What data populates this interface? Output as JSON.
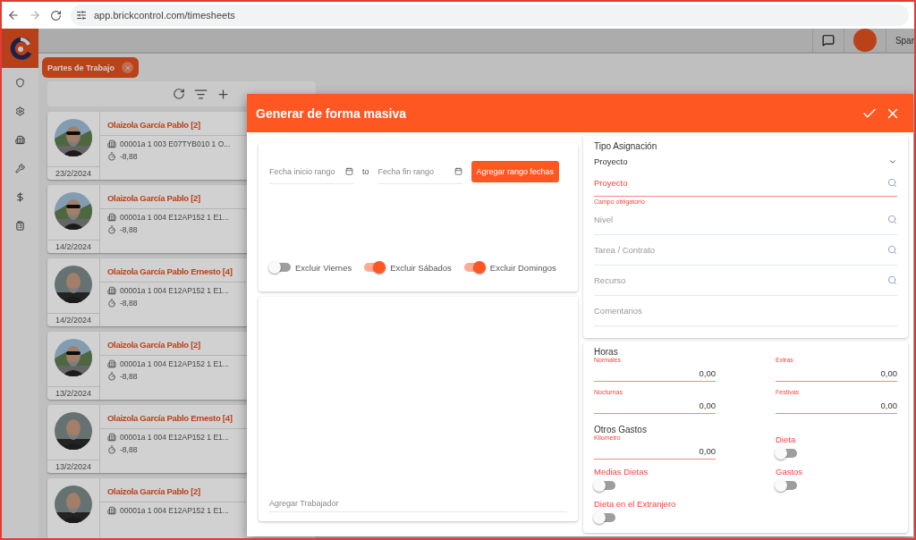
{
  "browser": {
    "url": "app.brickcontrol.com/timesheets"
  },
  "header": {
    "user_name": "Spar"
  },
  "tabs": [
    {
      "label": "Partes de Trabajo",
      "selected": true
    }
  ],
  "timesheets": [
    {
      "name": "Olaizola García Pablo [2]",
      "project": "00001a 1 003 E07TYB010 1 O...",
      "hours": "-8,88",
      "date": "23/2/2024"
    },
    {
      "name": "Olaizola García Pablo [2]",
      "project": "00001a 1 004 E12AP152 1 E1...",
      "hours": "-8,88",
      "date": "14/2/2024"
    },
    {
      "name": "Olaizola García Pablo Ernesto [4]",
      "project": "00001a 1 004 E12AP152 1 E1...",
      "hours": "-8,88",
      "date": "14/2/2024"
    },
    {
      "name": "Olaizola García Pablo [2]",
      "project": "00001a 1 004 E12AP152 1 E1...",
      "hours": "-8,88",
      "date": "13/2/2024"
    },
    {
      "name": "Olaizola García Pablo Ernesto [4]",
      "project": "00001a 1 004 E12AP152 1 E1...",
      "hours": "-8,88",
      "date": "13/2/2024"
    },
    {
      "name": "Olaizola García Pablo [2]",
      "project": "00001a 1 004 E12AP152 1 E1..."
    }
  ],
  "dialog": {
    "title": "Generar de forma masiva",
    "date_range": {
      "start_placeholder": "Fecha inicio rango",
      "separator": "to",
      "end_placeholder": "Fecha fin rango",
      "add_button": "Agregar rango fechas"
    },
    "exclusions": [
      {
        "label": "Excluir Viernes",
        "on": false
      },
      {
        "label": "Excluir Sábados",
        "on": true
      },
      {
        "label": "Excluir Domingos",
        "on": true
      }
    ],
    "worker_field": {
      "placeholder": "Agregar Trabajador"
    },
    "assignment": {
      "label": "Tipo Asignación",
      "value": "Proyecto",
      "search_fields": [
        {
          "placeholder": "Proyecto",
          "error": "Campo obligatorio"
        },
        {
          "placeholder": "Nivel"
        },
        {
          "placeholder": "Tarea / Contrato"
        },
        {
          "placeholder": "Recurso"
        }
      ],
      "comments": {
        "placeholder": "Comentarios"
      }
    },
    "hours": {
      "title": "Horas",
      "fields": [
        {
          "label": "Normales",
          "value": "0,00"
        },
        {
          "label": "Extras",
          "value": "0,00"
        },
        {
          "label": "Nocturnas",
          "value": "0,00"
        },
        {
          "label": "Festivas",
          "value": "0,00"
        }
      ]
    },
    "other_expenses": {
      "title": "Otros Gastos",
      "items": [
        {
          "kind": "number",
          "label": "Kilometro",
          "value": "0,00"
        },
        {
          "kind": "toggle",
          "label": "Dieta",
          "on": false
        },
        {
          "kind": "toggle",
          "label": "Medias Dietas",
          "on": false
        },
        {
          "kind": "toggle",
          "label": "Gastos",
          "on": false
        },
        {
          "kind": "toggle",
          "label": "Dieta en el Extranjero",
          "on": false
        }
      ]
    }
  }
}
